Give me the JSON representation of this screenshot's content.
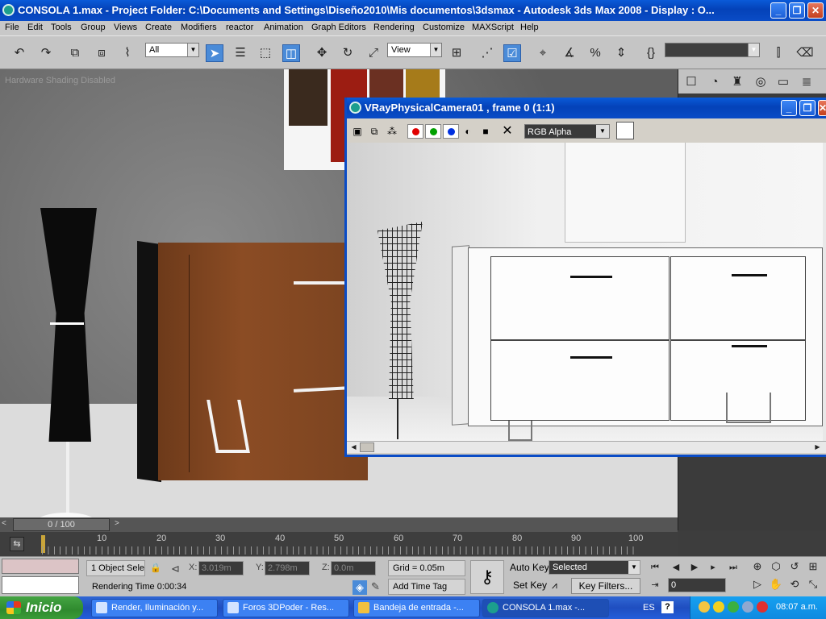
{
  "window": {
    "title": "CONSOLA 1.max     - Project Folder: C:\\Documents and Settings\\Diseño2010\\Mis documentos\\3dsmax     - Autodesk 3ds Max 2008     - Display : O...",
    "min": "_",
    "max": "❐",
    "close": "✕"
  },
  "menu": [
    "File",
    "Edit",
    "Tools",
    "Group",
    "Views",
    "Create",
    "Modifiers",
    "reactor",
    "Animation",
    "Graph Editors",
    "Rendering",
    "Customize",
    "MAXScript",
    "Help"
  ],
  "toolbar": {
    "selection_filter": "All",
    "ref_coord": "View",
    "named_selection": ""
  },
  "viewport": {
    "label": "Hardware Shading Disabled"
  },
  "vray": {
    "title": "VRayPhysicalCamera01 , frame 0 (1:1)",
    "channel": "RGB Alpha",
    "colors": {
      "red": "#e00000",
      "green": "#00a000",
      "blue": "#0030e0"
    },
    "min": "_",
    "max": "❐",
    "close": "✕"
  },
  "timeline": {
    "slider": "0 / 100",
    "labels": [
      "10",
      "20",
      "30",
      "40",
      "50",
      "60",
      "70",
      "80",
      "90",
      "100"
    ]
  },
  "status": {
    "selection": "1 Object Sele",
    "x_label": "X:",
    "x_value": "3.019m",
    "y_label": "Y:",
    "y_value": "2.798m",
    "z_label": "Z:",
    "z_value": "0.0m",
    "grid": "Grid = 0.05m",
    "rendering_time": "Rendering Time  0:00:34",
    "add_time_tag": "Add Time Tag",
    "auto_key": "Auto Key",
    "set_key": "Set Key",
    "key_mode": "Selected",
    "key_filters": "Key Filters...",
    "frame": "0"
  },
  "taskbar": {
    "start": "Inicio",
    "tasks": [
      "Render, Iluminación y...",
      "Foros 3DPoder - Res...",
      "Bandeja de entrada -...",
      "CONSOLA 1.max       -..."
    ],
    "lang": "ES",
    "help": "?",
    "clock": "08:07 a.m."
  }
}
